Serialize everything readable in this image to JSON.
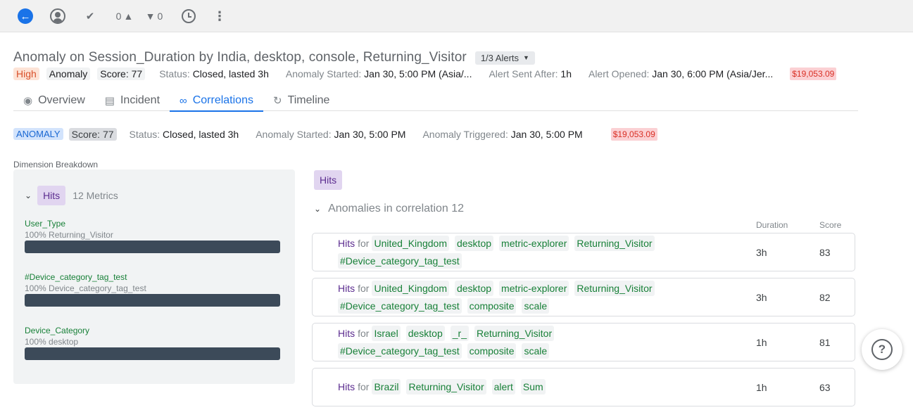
{
  "toolbar": {
    "back_icon": "arrow-left-icon",
    "avatar_icon": "user-avatar-icon",
    "assign_icon": "assign-user-icon",
    "likes": "0",
    "dislikes": "0",
    "snooze_icon": "alarm-clock-icon",
    "more_icon": "more-vertical-icon"
  },
  "header": {
    "title": "Anomaly on Session_Duration by India, desktop, console, Returning_Visitor",
    "alerts_button": "1/3 Alerts"
  },
  "meta": {
    "severity": "High",
    "type": "Anomaly",
    "score": "Score: 77",
    "status_label": "Status:",
    "status_value": "Closed, lasted 3h",
    "started_label": "Anomaly Started:",
    "started_value": "Jan 30, 5:00 PM (Asia/...",
    "sent_label": "Alert Sent After:",
    "sent_value": "1h",
    "opened_label": "Alert Opened:",
    "opened_value": "Jan 30, 6:00 PM (Asia/Jer...",
    "impact": "$19,053.09"
  },
  "tabs": [
    {
      "label": "Overview",
      "icon": "overview-icon"
    },
    {
      "label": "Incident",
      "icon": "clipboard-icon"
    },
    {
      "label": "Correlations",
      "icon": "link-icon"
    },
    {
      "label": "Timeline",
      "icon": "history-icon"
    }
  ],
  "sub": {
    "badge": "ANOMALY",
    "score": "Score: 77",
    "status_label": "Status:",
    "status_value": "Closed, lasted 3h",
    "started_label": "Anomaly Started:",
    "started_value": "Jan 30, 5:00 PM",
    "triggered_label": "Anomaly Triggered:",
    "triggered_value": "Jan 30, 5:00 PM",
    "impact": "$19,053.09"
  },
  "dimension": {
    "title": "Dimension Breakdown",
    "metric": "Hits",
    "metrics_count": "12 Metrics",
    "items": [
      {
        "name": "User_Type",
        "sub": "100% Returning_Visitor",
        "share": 1.0
      },
      {
        "name": "#Device_category_tag_test",
        "sub": "100% Device_category_tag_test",
        "share": 1.0
      },
      {
        "name": "Device_Category",
        "sub": "100% desktop",
        "share": 1.0
      }
    ]
  },
  "correlations": {
    "metric_tag": "Hits",
    "heading": "Anomalies in correlation 12",
    "col_duration": "Duration",
    "col_score": "Score",
    "rows": [
      {
        "metric": "Hits",
        "for": "for",
        "tags": [
          "United_Kingdom",
          "desktop",
          "metric-explorer",
          "Returning_Visitor",
          "#Device_category_tag_test"
        ],
        "duration": "3h",
        "score": "83"
      },
      {
        "metric": "Hits",
        "for": "for",
        "tags": [
          "United_Kingdom",
          "desktop",
          "metric-explorer",
          "Returning_Visitor",
          "#Device_category_tag_test",
          "composite",
          "scale"
        ],
        "duration": "3h",
        "score": "82"
      },
      {
        "metric": "Hits",
        "for": "for",
        "tags": [
          "Israel",
          "desktop",
          "_r_",
          "Returning_Visitor",
          "#Device_category_tag_test",
          "composite",
          "scale"
        ],
        "duration": "1h",
        "score": "81"
      },
      {
        "metric": "Hits",
        "for": "for",
        "tags": [
          "Brazil",
          "Returning_Visitor",
          "alert",
          "Sum"
        ],
        "duration": "1h",
        "score": "63"
      }
    ]
  },
  "help_icon": "help-question-icon"
}
